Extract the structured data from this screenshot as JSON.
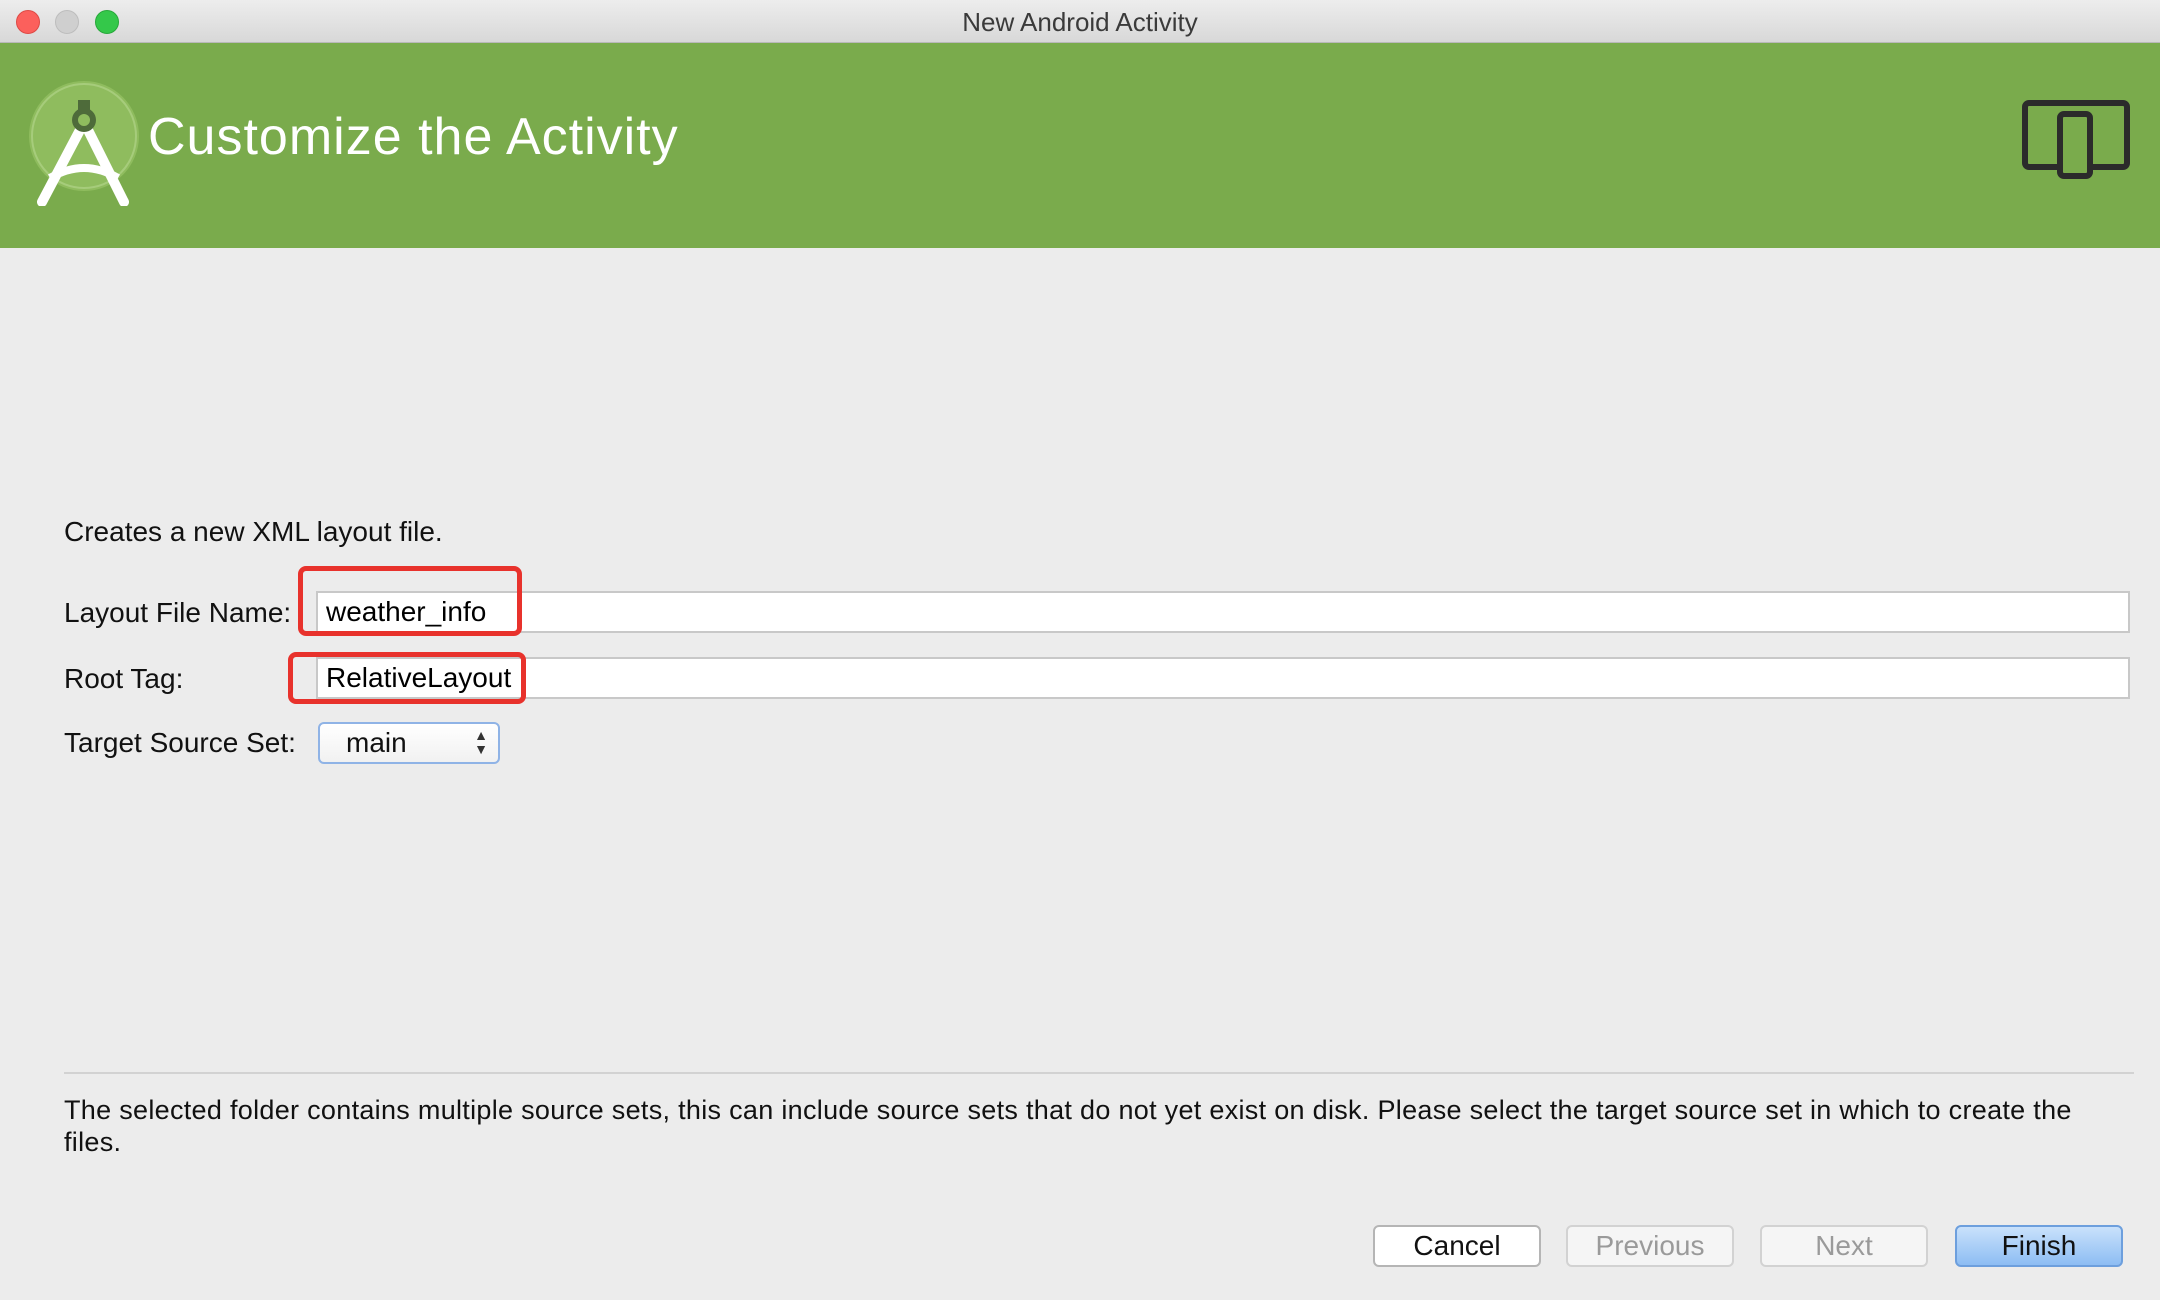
{
  "window": {
    "title": "New Android Activity"
  },
  "header": {
    "title": "Customize the Activity",
    "logo_icon": "android-studio-logo-icon",
    "device_icon": "tablet-phone-icon",
    "background_color": "#7aab4c"
  },
  "form": {
    "description": "Creates a new XML layout file.",
    "layout_file_name": {
      "label": "Layout File Name:",
      "value": "weather_info"
    },
    "root_tag": {
      "label": "Root Tag:",
      "value": "RelativeLayout"
    },
    "target_source_set": {
      "label": "Target Source Set:",
      "selected": "main"
    }
  },
  "footer": {
    "help_text": "The selected folder contains multiple source sets, this can include source sets that do not yet exist on disk. Please select the target source set in which to create the files."
  },
  "buttons": {
    "cancel": "Cancel",
    "previous": "Previous",
    "next": "Next",
    "finish": "Finish"
  },
  "colors": {
    "highlight": "#e8322c",
    "accent_button": "#8dbdf3"
  }
}
